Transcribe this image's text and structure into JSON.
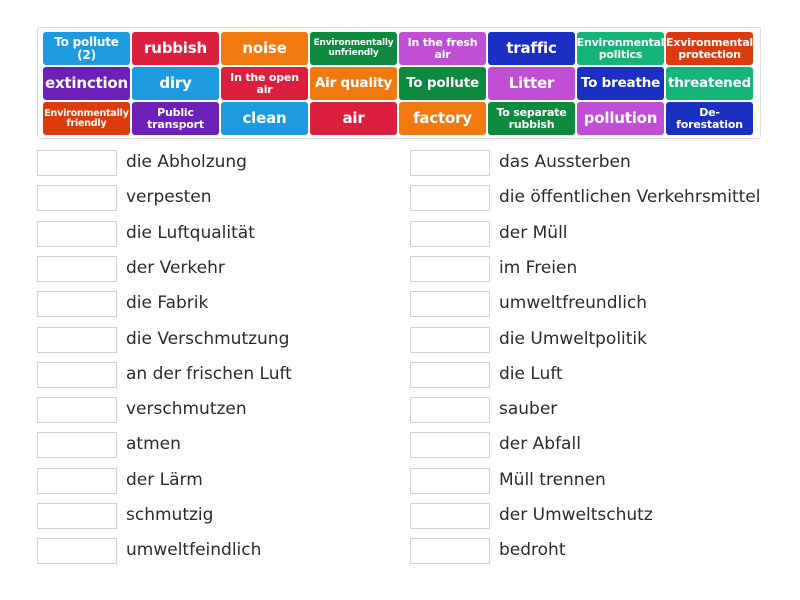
{
  "tiles": [
    {
      "label": "To pollute (2)",
      "color": "#1e9be0",
      "size": "t-m"
    },
    {
      "label": "rubbish",
      "color": "#dc1f3f",
      "size": "t-xl"
    },
    {
      "label": "noise",
      "color": "#f07a10",
      "size": "t-xl"
    },
    {
      "label": "Environmentally unfriendly",
      "color": "#0d8a3e",
      "size": "t-xxs"
    },
    {
      "label": "In the fresh air",
      "color": "#c04fd6",
      "size": "t-s"
    },
    {
      "label": "traffic",
      "color": "#1b2fc2",
      "size": "t-xl"
    },
    {
      "label": "Environmental politics",
      "color": "#15b57a",
      "size": "t-s"
    },
    {
      "label": "Exvironmental protection",
      "color": "#dd3a0d",
      "size": "t-s"
    },
    {
      "label": "extinction",
      "color": "#6c20b8",
      "size": "t-xl"
    },
    {
      "label": "diry",
      "color": "#1e9be0",
      "size": "t-xl"
    },
    {
      "label": "In the open air",
      "color": "#dc1f3f",
      "size": "t-s"
    },
    {
      "label": "Air quality",
      "color": "#f07a10",
      "size": "t-l"
    },
    {
      "label": "To pollute",
      "color": "#0d8a3e",
      "size": "t-l"
    },
    {
      "label": "Litter",
      "color": "#c04fd6",
      "size": "t-xl"
    },
    {
      "label": "To breathe",
      "color": "#1b2fc2",
      "size": "t-l"
    },
    {
      "label": "threatened",
      "color": "#15b57a",
      "size": "t-l"
    },
    {
      "label": "Environmentally friendly",
      "color": "#dd3a0d",
      "size": "t-xs"
    },
    {
      "label": "Public transport",
      "color": "#6c20b8",
      "size": "t-s"
    },
    {
      "label": "clean",
      "color": "#1e9be0",
      "size": "t-xl"
    },
    {
      "label": "air",
      "color": "#dc1f3f",
      "size": "t-xl"
    },
    {
      "label": "factory",
      "color": "#f07a10",
      "size": "t-xl"
    },
    {
      "label": "To separate rubbish",
      "color": "#0d8a3e",
      "size": "t-s"
    },
    {
      "label": "pollution",
      "color": "#c04fd6",
      "size": "t-xl"
    },
    {
      "label": "De-forestation",
      "color": "#1b2fc2",
      "size": "t-s"
    }
  ],
  "left_terms": [
    "die Abholzung",
    "verpesten",
    "die Luftqualität",
    "der Verkehr",
    "die Fabrik",
    "die Verschmutzung",
    "an der frischen Luft",
    "verschmutzen",
    "atmen",
    "der Lärm",
    "schmutzig",
    "umweltfeindlich"
  ],
  "right_terms": [
    "das Aussterben",
    "die öffentlichen Verkehrsmittel",
    "der Müll",
    "im Freien",
    "umweltfreundlich",
    "die Umweltpolitik",
    "die Luft",
    "sauber",
    "der Abfall",
    "Müll trennen",
    "der Umweltschutz",
    "bedroht"
  ]
}
